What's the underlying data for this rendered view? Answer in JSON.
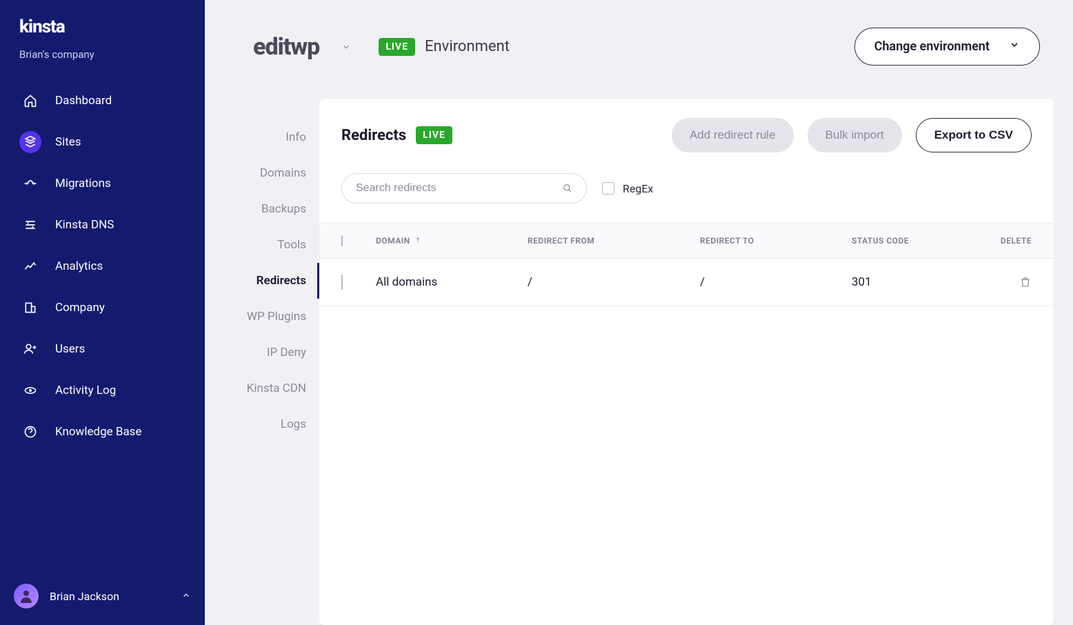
{
  "brand": "kinsta",
  "company": "Brian's company",
  "nav": [
    {
      "label": "Dashboard",
      "icon": "home"
    },
    {
      "label": "Sites",
      "icon": "sites",
      "active": true
    },
    {
      "label": "Migrations",
      "icon": "migrations"
    },
    {
      "label": "Kinsta DNS",
      "icon": "dns"
    },
    {
      "label": "Analytics",
      "icon": "analytics"
    },
    {
      "label": "Company",
      "icon": "company"
    },
    {
      "label": "Users",
      "icon": "users"
    },
    {
      "label": "Activity Log",
      "icon": "activity"
    },
    {
      "label": "Knowledge Base",
      "icon": "help"
    }
  ],
  "user": "Brian Jackson",
  "site": {
    "name": "editwp",
    "env_badge": "LIVE",
    "env_label": "Environment",
    "change_env": "Change environment"
  },
  "subnav": [
    "Info",
    "Domains",
    "Backups",
    "Tools",
    "Redirects",
    "WP Plugins",
    "IP Deny",
    "Kinsta CDN",
    "Logs"
  ],
  "subnav_active": "Redirects",
  "panel": {
    "title": "Redirects",
    "badge": "LIVE",
    "buttons": {
      "add": "Add redirect rule",
      "bulk": "Bulk import",
      "export": "Export to CSV"
    },
    "search_placeholder": "Search redirects",
    "regex_label": "RegEx",
    "columns": {
      "domain": "DOMAIN",
      "from": "REDIRECT FROM",
      "to": "REDIRECT TO",
      "status": "STATUS CODE",
      "delete": "DELETE"
    },
    "rows": [
      {
        "domain": "All domains",
        "from": "/",
        "to": "/",
        "status": "301"
      }
    ]
  }
}
